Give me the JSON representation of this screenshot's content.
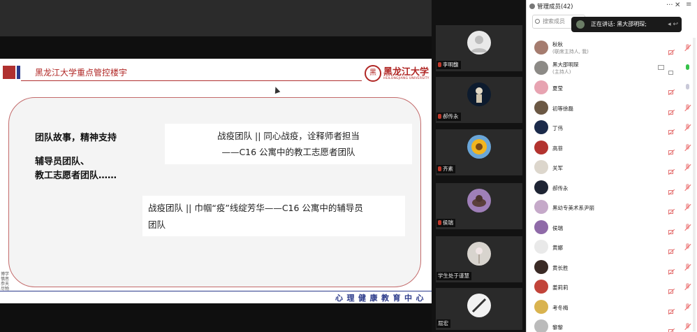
{
  "slide": {
    "header_title": "黑龙江大学重点管控楼宇",
    "logo_name": "黑龙江大学",
    "logo_seal": "黑",
    "logo_sub": "HEILONGJIANG UNIVERSITY",
    "left_line1": "团队故事，精神支持",
    "left_line2": "辅导员团队、",
    "left_line3": "教工志愿者团队……",
    "card1_line1": "战疫团队 || 同心战疫，诠释师者担当",
    "card1_line2": "——C16 公寓中的教工志愿者团队",
    "card2_line1": "战疫团队 || 巾帼“疫”线绽芳华——C16 公寓中的辅导员",
    "card2_line2": "团队",
    "footer": "心理健康教育中心",
    "signature": "博学慎思参天尽物"
  },
  "video_tiles": [
    {
      "name": "李明馥",
      "avatar": "default-user-icon"
    },
    {
      "name": "郝传永",
      "avatar": "dark-figure-photo"
    },
    {
      "name": "齐素",
      "avatar": "sunflower-photo"
    },
    {
      "name": "侯瑞",
      "avatar": "purple-dog-photo"
    },
    {
      "name": "学生处于谨慧",
      "avatar": "flower-photo"
    },
    {
      "name": "屈宏",
      "avatar": "camera-off-icon"
    }
  ],
  "panel": {
    "title": "管理成员(42)",
    "search_placeholder": "搜索成员",
    "more_label": "···",
    "close_label": "✕",
    "menu_label": "≡",
    "toast_text": "正在讲话: 黑大邵明琛;"
  },
  "members": [
    {
      "name": "秋秋",
      "role": "(联席主持人, 我)",
      "avatar_color": "#a57c6f",
      "mic": "muted",
      "screen": false
    },
    {
      "name": "黑大邵明琛",
      "role": "(主持人)",
      "avatar_color": "#8c8a86",
      "mic": "speaking",
      "screen": true
    },
    {
      "name": "夏莹",
      "role": "",
      "avatar_color": "#e7a3b1",
      "mic": "off",
      "screen": false
    },
    {
      "name": "初等徐磊",
      "role": "",
      "avatar_color": "#6b5844",
      "mic": "muted",
      "screen": false
    },
    {
      "name": "丁伟",
      "role": "",
      "avatar_color": "#1b2a4a",
      "mic": "muted",
      "screen": false
    },
    {
      "name": "高菲",
      "role": "",
      "avatar_color": "#b3332f",
      "mic": "muted",
      "screen": false
    },
    {
      "name": "关军",
      "role": "",
      "avatar_color": "#dcd6cc",
      "mic": "muted",
      "screen": false
    },
    {
      "name": "郝传永",
      "role": "",
      "avatar_color": "#1e2433",
      "mic": "muted",
      "screen": false
    },
    {
      "name": "黑幼专美术系尹丽",
      "role": "",
      "avatar_color": "#c5a9c9",
      "mic": "muted",
      "screen": false
    },
    {
      "name": "侯瑞",
      "role": "",
      "avatar_color": "#8f6aa8",
      "mic": "muted",
      "screen": false
    },
    {
      "name": "黄娜",
      "role": "",
      "avatar_color": "#e9e9e9",
      "mic": "muted",
      "screen": false
    },
    {
      "name": "黄长胜",
      "role": "",
      "avatar_color": "#3a2a25",
      "mic": "muted",
      "screen": false
    },
    {
      "name": "姜莉莉",
      "role": "",
      "avatar_color": "#c2443a",
      "mic": "muted",
      "screen": false
    },
    {
      "name": "考冬梅",
      "role": "",
      "avatar_color": "#d9b34f",
      "mic": "muted",
      "screen": false
    },
    {
      "name": "黎黎",
      "role": "",
      "avatar_color": "#bbbbbb",
      "mic": "muted",
      "screen": false
    }
  ]
}
